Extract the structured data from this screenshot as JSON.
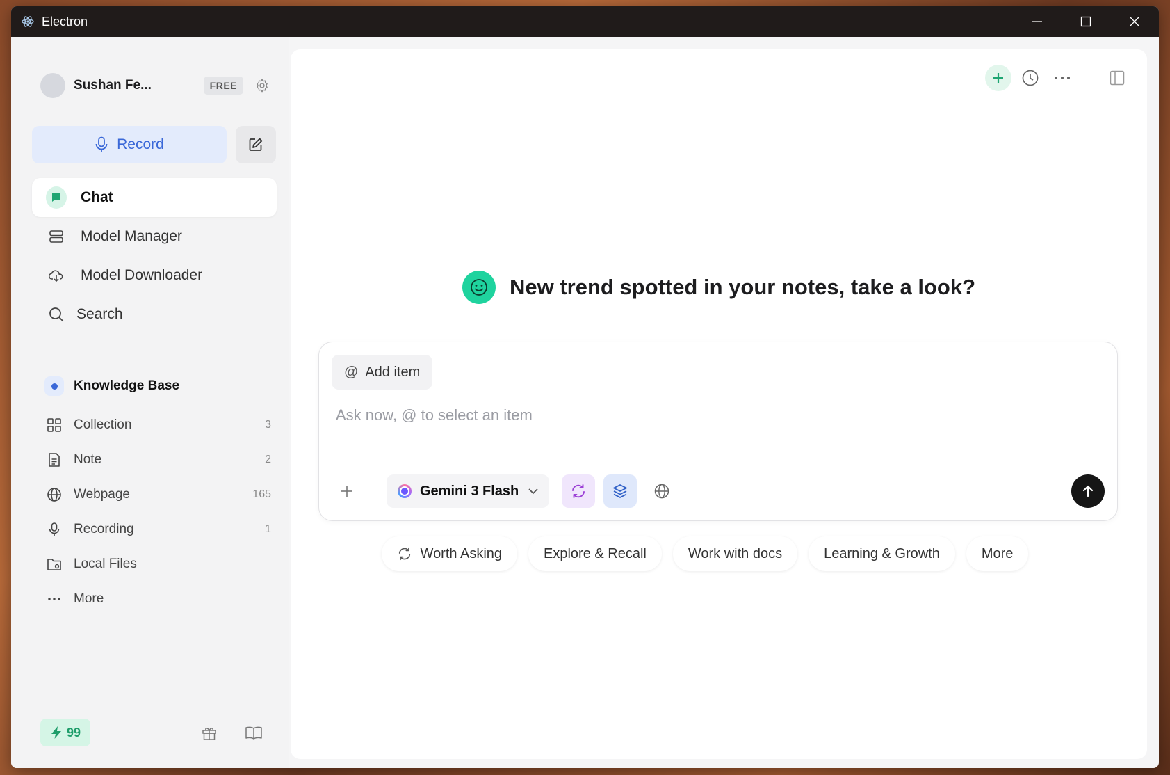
{
  "window": {
    "title": "Electron"
  },
  "sidebar": {
    "user": {
      "name": "Sushan Fe...",
      "plan_badge": "FREE"
    },
    "record_label": "Record",
    "nav": [
      {
        "label": "Chat",
        "icon": "chat-icon",
        "active": true
      },
      {
        "label": "Model Manager",
        "icon": "server-icon"
      },
      {
        "label": "Model Downloader",
        "icon": "cloud-download-icon"
      },
      {
        "label": "Search",
        "icon": "search-icon"
      }
    ],
    "knowledge_base": {
      "title": "Knowledge Base",
      "items": [
        {
          "label": "Collection",
          "count": "3",
          "icon": "grid-icon"
        },
        {
          "label": "Note",
          "count": "2",
          "icon": "document-icon"
        },
        {
          "label": "Webpage",
          "count": "165",
          "icon": "globe-icon"
        },
        {
          "label": "Recording",
          "count": "1",
          "icon": "microphone-icon"
        },
        {
          "label": "Local Files",
          "count": "",
          "icon": "folder-icon"
        },
        {
          "label": "More",
          "count": "",
          "icon": "ellipsis-icon"
        }
      ]
    },
    "credits": "99"
  },
  "main": {
    "headline": "New trend spotted in your notes, take a look?",
    "composer": {
      "add_item_label": "Add item",
      "placeholder": "Ask now, @ to select an item",
      "value": "",
      "model": "Gemini 3 Flash"
    },
    "suggestions": [
      "Worth Asking",
      "Explore & Recall",
      "Work with docs",
      "Learning & Growth",
      "More"
    ]
  },
  "colors": {
    "accent_blue": "#3a68d8",
    "accent_green": "#1fd39e",
    "credits_green": "#1e9d6a",
    "titlebar": "#201b1a"
  }
}
